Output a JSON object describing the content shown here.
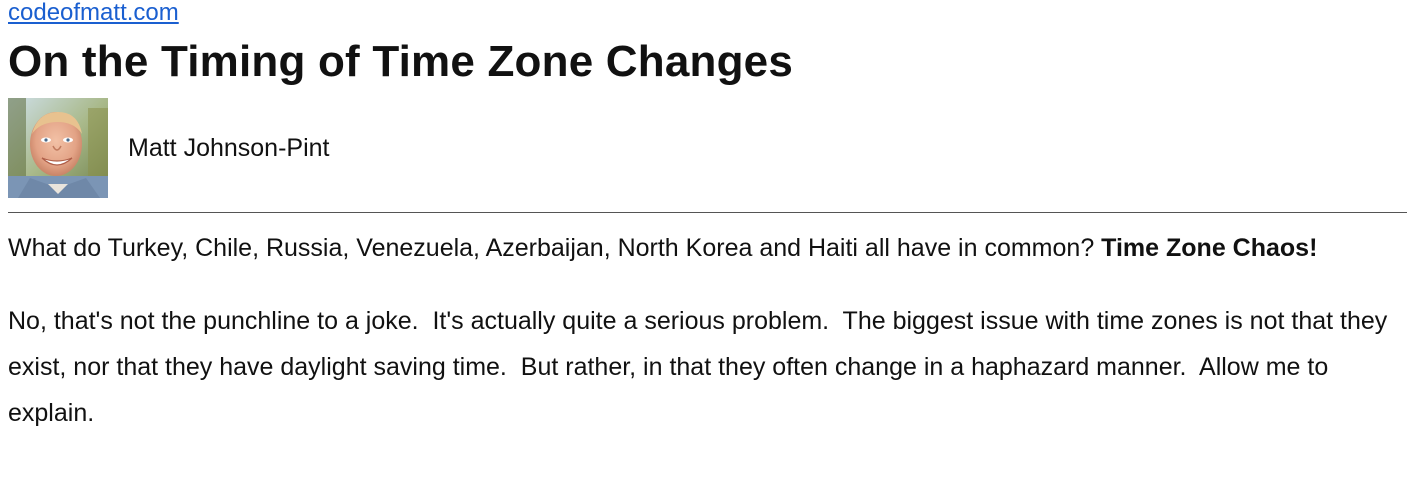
{
  "site": {
    "link_text": "codeofmatt.com"
  },
  "article": {
    "title": "On the Timing of Time Zone Changes",
    "author_name": "Matt Johnson-Pint",
    "paragraphs": {
      "p1_text": "What do Turkey, Chile, Russia, Venezuela, Azerbaijan, North Korea and Haiti all have in common? ",
      "p1_bold": "Time Zone Chaos!",
      "p2_text": "No, that's not the punchline to a joke.  It's actually quite a serious problem.  The biggest issue with time zones is not that they exist, nor that they have daylight saving time.  But rather, in that they often change in a haphazard manner.  Allow me to explain."
    }
  },
  "colors": {
    "link": "#1a5fd0",
    "text": "#111111",
    "rule": "#555555",
    "background": "#ffffff"
  }
}
